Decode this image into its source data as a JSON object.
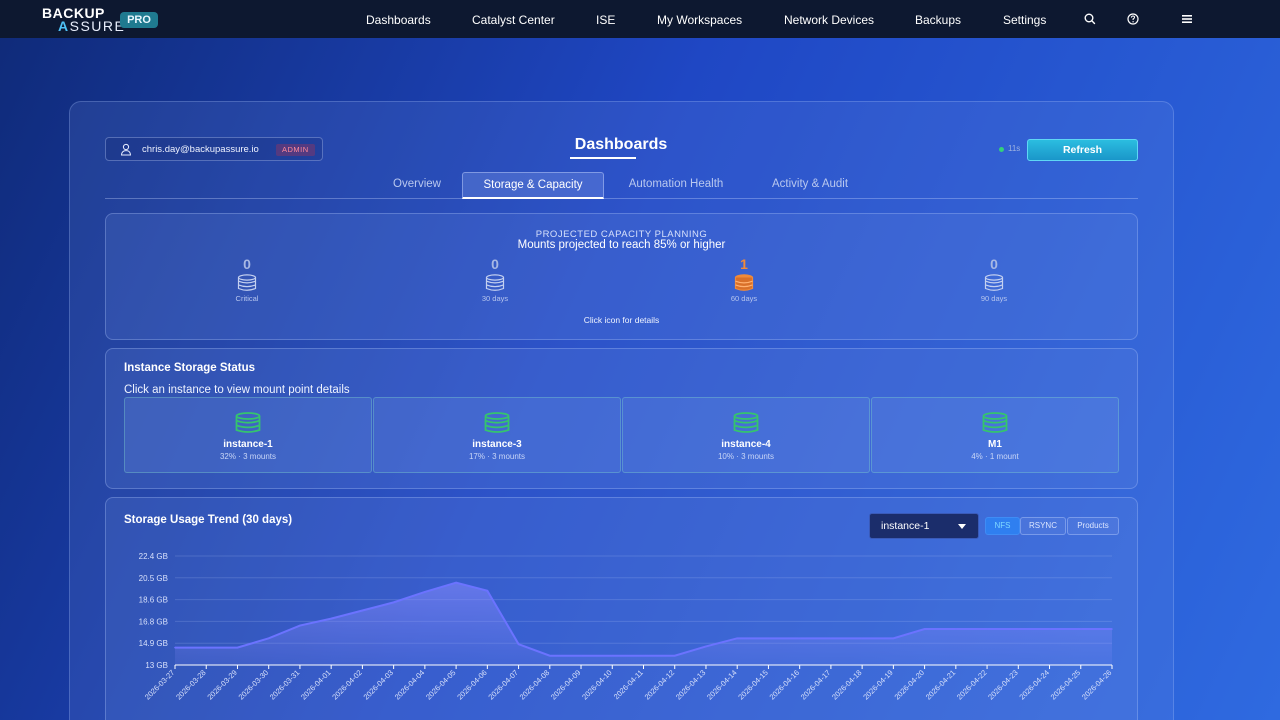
{
  "nav": {
    "logo_line1": "BACKUP",
    "logo_a": "A",
    "logo_line2_rest": "SSURE",
    "logo_badge": "PRO",
    "items": [
      "Dashboards",
      "Catalyst Center",
      "ISE",
      "My Workspaces",
      "Network Devices",
      "Backups",
      "Settings"
    ],
    "icons": [
      "search-icon",
      "help-icon",
      "menu-icon"
    ]
  },
  "header": {
    "user_email": "chris.day@backupassure.io",
    "user_role": "ADMIN",
    "title": "Dashboards",
    "live_text": "11s",
    "refresh_label": "Refresh"
  },
  "tabs": [
    "Overview",
    "Storage & Capacity",
    "Automation Health",
    "Activity & Audit"
  ],
  "active_tab": "Storage & Capacity",
  "capacity": {
    "heading": "PROJECTED CAPACITY PLANNING",
    "subheading": "Mounts projected to reach 85% or higher",
    "items": [
      {
        "count": "0",
        "label": "Critical",
        "highlight": false
      },
      {
        "count": "0",
        "label": "30 days",
        "highlight": false
      },
      {
        "count": "1",
        "label": "60 days",
        "highlight": true
      },
      {
        "count": "0",
        "label": "90 days",
        "highlight": false
      }
    ],
    "hint": "Click icon for details"
  },
  "instances": {
    "title": "Instance Storage Status",
    "subtitle": "Click an instance to view mount point details",
    "items": [
      {
        "name": "instance-1",
        "meta": "32% · 3 mounts"
      },
      {
        "name": "instance-3",
        "meta": "17% · 3 mounts"
      },
      {
        "name": "instance-4",
        "meta": "10% · 3 mounts"
      },
      {
        "name": "M1",
        "meta": "4% · 1 mount"
      }
    ]
  },
  "trend": {
    "title": "Storage Usage Trend (30 days)",
    "selected_instance": "instance-1",
    "filters": [
      "NFS",
      "RSYNC",
      "Products"
    ],
    "active_filter": "NFS"
  },
  "colors": {
    "accent": "#2bbde0",
    "highlight": "#f08a3a",
    "db_green": "#35c46e",
    "line": "#6b73ff"
  },
  "chart_data": {
    "type": "area",
    "title": "Storage Usage Trend (30 days)",
    "xlabel": "",
    "ylabel": "",
    "y_ticks": [
      "22.4 GB",
      "20.5 GB",
      "18.6 GB",
      "16.8 GB",
      "14.9 GB",
      "13 GB"
    ],
    "ylim": [
      13,
      22.4
    ],
    "x": [
      "2026-03-27",
      "2026-03-28",
      "2026-03-29",
      "2026-03-30",
      "2026-03-31",
      "2026-04-01",
      "2026-04-02",
      "2026-04-03",
      "2026-04-04",
      "2026-04-05",
      "2026-04-06",
      "2026-04-07",
      "2026-04-08",
      "2026-04-09",
      "2026-04-10",
      "2026-04-11",
      "2026-04-12",
      "2026-04-13",
      "2026-04-14",
      "2026-04-15",
      "2026-04-16",
      "2026-04-17",
      "2026-04-18",
      "2026-04-19",
      "2026-04-20",
      "2026-04-21",
      "2026-04-22",
      "2026-04-23",
      "2026-04-24",
      "2026-04-25",
      "2026-04-26"
    ],
    "values": [
      14.5,
      14.5,
      14.5,
      15.3,
      16.4,
      17.0,
      17.7,
      18.4,
      19.3,
      20.1,
      19.4,
      14.8,
      13.8,
      13.8,
      13.8,
      13.8,
      13.8,
      14.6,
      15.3,
      15.3,
      15.3,
      15.3,
      15.3,
      15.3,
      16.1,
      16.1,
      16.1,
      16.1,
      16.1,
      16.1,
      16.1
    ],
    "grid": true,
    "legend": "none"
  }
}
